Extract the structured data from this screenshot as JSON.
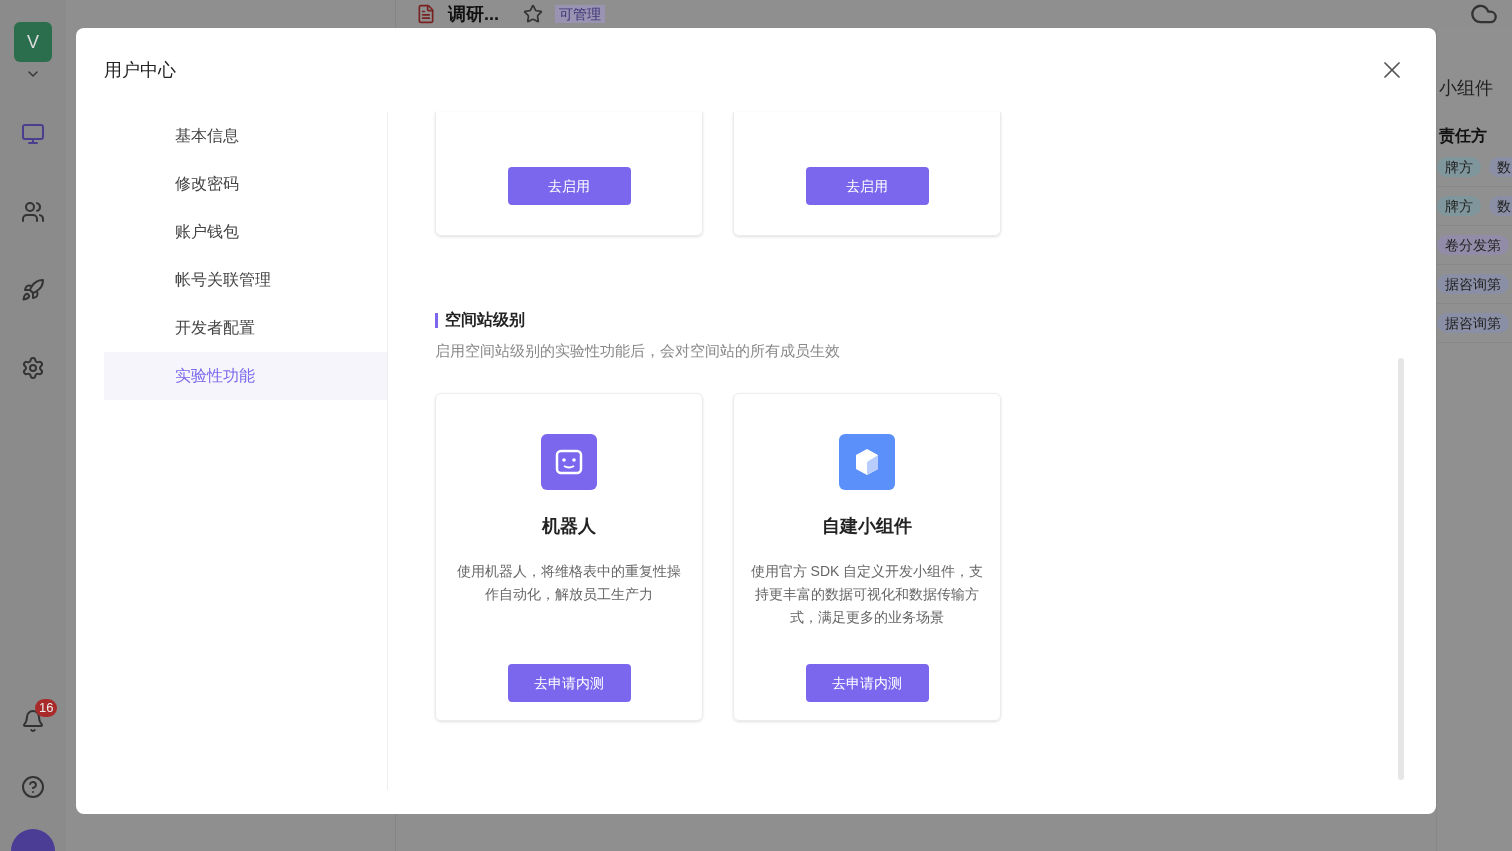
{
  "background": {
    "space_avatar": "V",
    "doc_title": "调研...",
    "permission_badge": "可管理",
    "notification_count": "16",
    "right_panel": {
      "title": "小组件",
      "column_header": "责任方",
      "rows": [
        {
          "tags": [
            {
              "text": "牌方",
              "color": "#7f979c"
            },
            {
              "text": "数",
              "color": "#8a8fa6"
            }
          ]
        },
        {
          "tags": [
            {
              "text": "牌方",
              "color": "#7f979c"
            },
            {
              "text": "数",
              "color": "#8a8fa6"
            }
          ]
        },
        {
          "tags": [
            {
              "text": "卷分发第",
              "color": "#938ca8"
            }
          ]
        },
        {
          "tags": [
            {
              "text": "据咨询第",
              "color": "#8a8fa6"
            }
          ]
        },
        {
          "tags": [
            {
              "text": "据咨询第",
              "color": "#8a8fa6"
            }
          ]
        }
      ]
    }
  },
  "dialog": {
    "title": "用户中心",
    "nav": [
      {
        "label": "基本信息",
        "selected": false
      },
      {
        "label": "修改密码",
        "selected": false
      },
      {
        "label": "账户钱包",
        "selected": false
      },
      {
        "label": "帐号关联管理",
        "selected": false
      },
      {
        "label": "开发者配置",
        "selected": false
      },
      {
        "label": "实验性功能",
        "selected": true
      }
    ],
    "top_cards": [
      {
        "button": "去启用"
      },
      {
        "button": "去启用"
      }
    ],
    "section": {
      "title": "空间站级别",
      "description": "启用空间站级别的实验性功能后，会对空间站的所有成员生效"
    },
    "cards": [
      {
        "kind": "robot",
        "title": "机器人",
        "description": "使用机器人，将维格表中的重复性操作自动化，解放员工生产力",
        "button": "去申请内测"
      },
      {
        "kind": "widget",
        "title": "自建小组件",
        "description": "使用官方 SDK 自定义开发小组件，支持更丰富的数据可视化和数据传输方式，满足更多的业务场景",
        "button": "去申请内测"
      }
    ]
  }
}
